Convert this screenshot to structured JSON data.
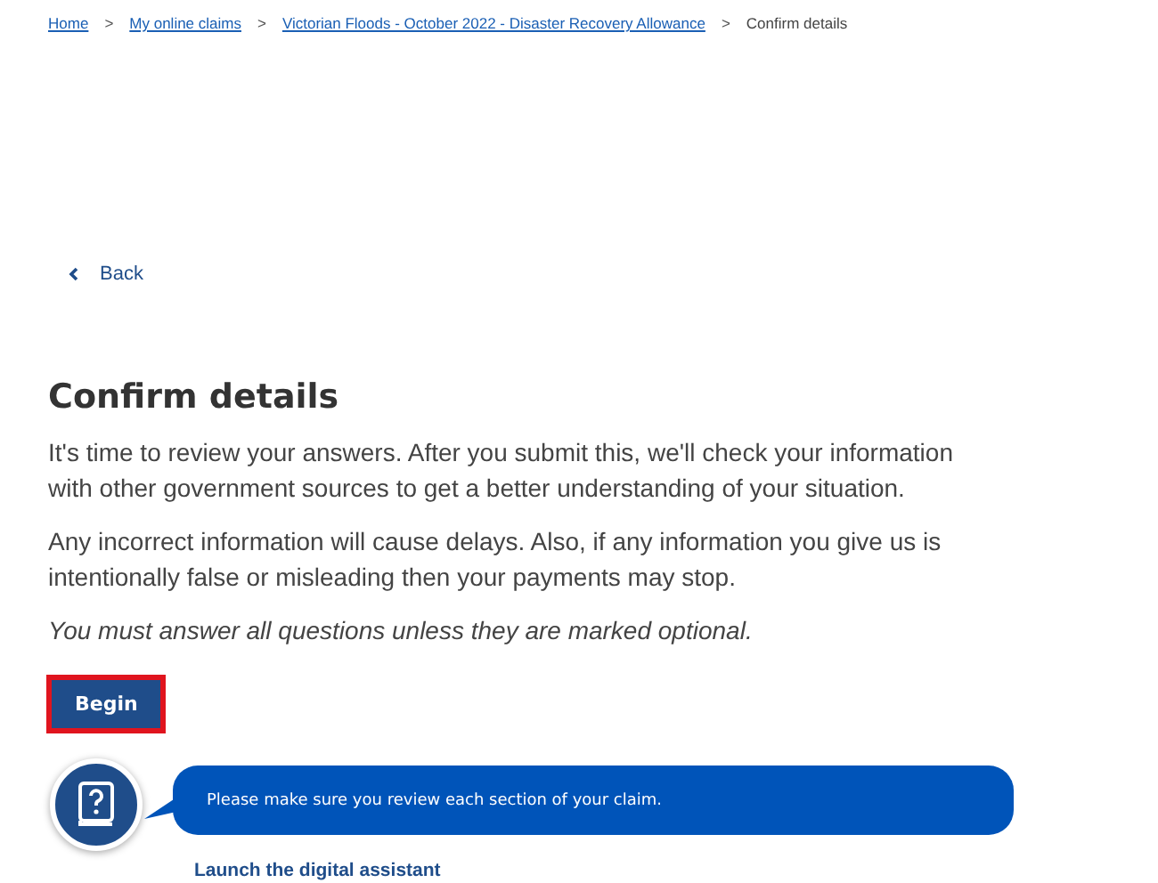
{
  "breadcrumb": {
    "links": [
      "Home",
      "My online claims",
      "Victorian Floods - October 2022 - Disaster Recovery Allowance"
    ],
    "separator": ">",
    "current": "Confirm details"
  },
  "back": {
    "label": "Back"
  },
  "heading": "Confirm details",
  "paragraphs": [
    "It's time to review your answers. After you submit this, we'll check your information with other government sources to get a better understanding of your situation.",
    "Any incorrect information will cause delays. Also, if any information you give us is intentionally false or misleading then your payments may stop."
  ],
  "note": "You must answer all questions unless they are marked optional.",
  "begin_button": {
    "label": "Begin",
    "focused": true
  },
  "assistant": {
    "message": "Please make sure you review each section of your claim.",
    "link": "Launch the digital assistant"
  }
}
